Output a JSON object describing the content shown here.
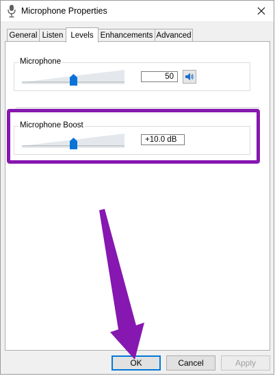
{
  "window": {
    "title": "Microphone Properties"
  },
  "tabs": [
    {
      "label": "General"
    },
    {
      "label": "Listen"
    },
    {
      "label": "Levels"
    },
    {
      "label": "Enhancements"
    },
    {
      "label": "Advanced"
    }
  ],
  "active_tab": "Levels",
  "levels": {
    "microphone": {
      "label": "Microphone",
      "value": "50",
      "slider_fraction": 0.5,
      "icon": "speaker-icon"
    },
    "boost": {
      "label": "Microphone Boost",
      "value": "+10.0 dB",
      "slider_fraction": 0.5
    }
  },
  "buttons": {
    "ok": "OK",
    "cancel": "Cancel",
    "apply": "Apply"
  },
  "colors": {
    "highlight": "#8617b0",
    "accent": "#0078d7"
  }
}
